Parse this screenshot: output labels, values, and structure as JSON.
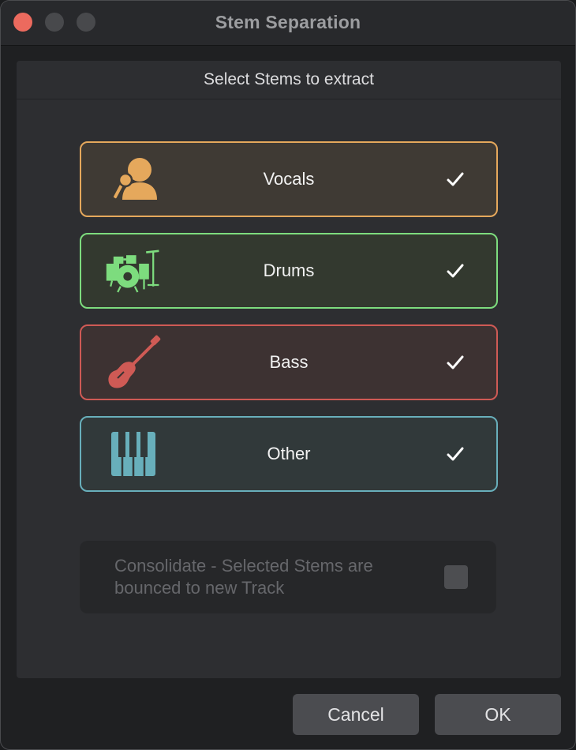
{
  "window": {
    "title": "Stem Separation"
  },
  "panel": {
    "header": "Select Stems to extract"
  },
  "stems": [
    {
      "label": "Vocals",
      "icon": "singer-microphone-icon",
      "color": "#e5a85c",
      "checked": true
    },
    {
      "label": "Drums",
      "icon": "drum-kit-icon",
      "color": "#7ddc7e",
      "checked": true
    },
    {
      "label": "Bass",
      "icon": "bass-guitar-icon",
      "color": "#cf5a55",
      "checked": true
    },
    {
      "label": "Other",
      "icon": "piano-keys-icon",
      "color": "#68afbb",
      "checked": true
    }
  ],
  "consolidate": {
    "label": "Consolidate - Selected Stems are bounced to new Track",
    "checked": false,
    "enabled": false
  },
  "buttons": {
    "cancel": "Cancel",
    "ok": "OK"
  }
}
